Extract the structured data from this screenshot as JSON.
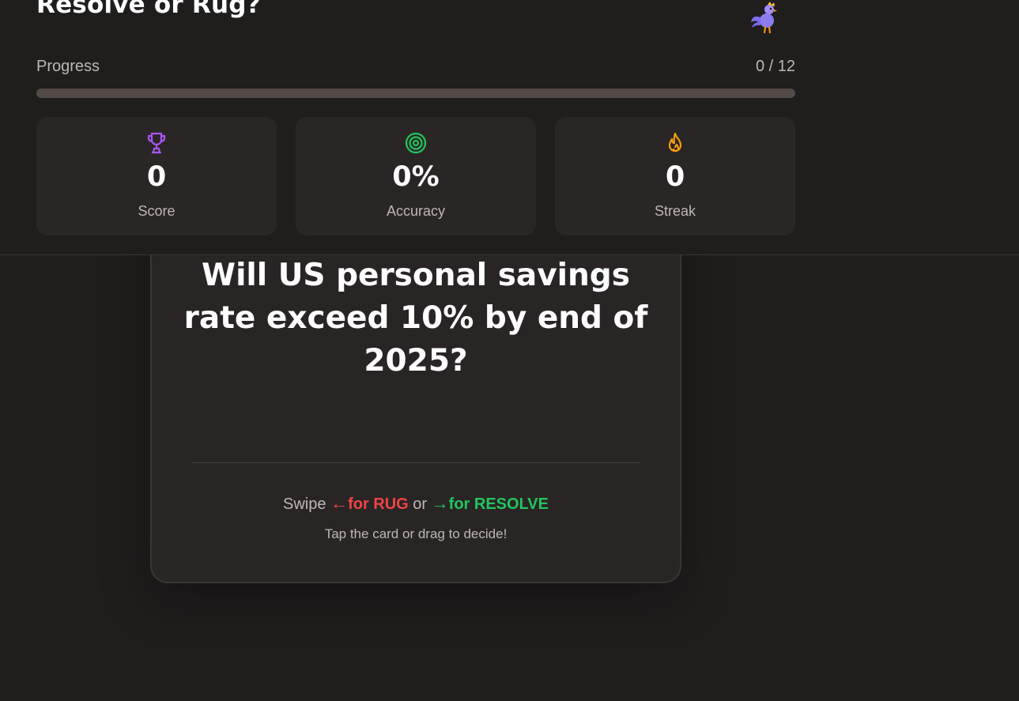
{
  "header": {
    "title": "Resolve or Rug?",
    "progress_label": "Progress",
    "progress_count": "0 / 12",
    "progress_value": 0
  },
  "stats": [
    {
      "icon": "trophy-icon",
      "value": "0",
      "label": "Score",
      "color": "#a855f7"
    },
    {
      "icon": "target-icon",
      "value": "0%",
      "label": "Accuracy",
      "color": "#22c55e"
    },
    {
      "icon": "flame-icon",
      "value": "0",
      "label": "Streak",
      "color": "#f59e0b"
    }
  ],
  "card": {
    "question": "Will US personal savings rate exceed 10% by end of 2025?",
    "swipe_prefix": "Swipe",
    "left_arrow": "←",
    "rug_text": "for RUG",
    "or_text": "or",
    "right_arrow": "→",
    "resolve_text": "for RESOLVE",
    "hint": "Tap the card or drag to decide!"
  },
  "colors": {
    "background": "#201d1d",
    "card": "#2a2525",
    "rug": "#ef4444",
    "resolve": "#22c55e",
    "accent": "#8b5cf6"
  }
}
